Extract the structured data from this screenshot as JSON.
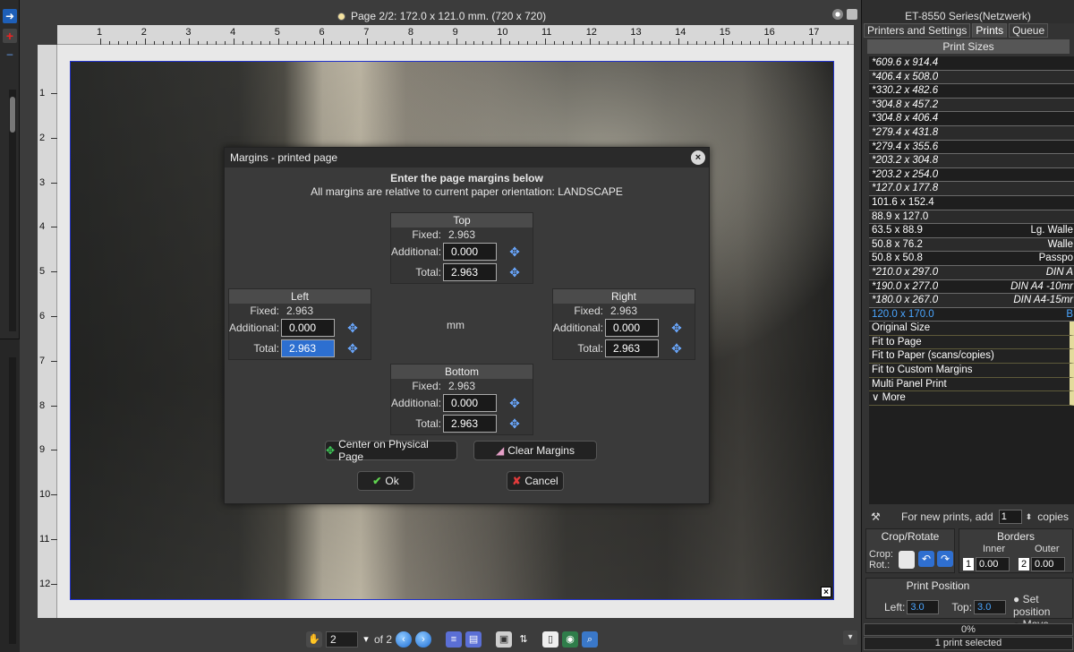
{
  "preview": {
    "page_info": "Page 2/2: 172.0 x 121.0 mm.  (720 x 720)",
    "ruler_top": [
      "1",
      "2",
      "3",
      "4",
      "5",
      "6",
      "7",
      "8",
      "9",
      "10",
      "11",
      "12",
      "13",
      "14",
      "15",
      "16",
      "17"
    ],
    "ruler_left": [
      "1",
      "2",
      "3",
      "4",
      "5",
      "6",
      "7",
      "8",
      "9",
      "10",
      "11",
      "12"
    ],
    "photo_close": "×"
  },
  "bottom_bar": {
    "page_value": "2",
    "of_label": "of 2"
  },
  "dialog": {
    "title": "Margins - printed page",
    "close": "×",
    "heading": "Enter the page margins below",
    "subheading": "All margins are relative to current paper orientation: LANDSCAPE",
    "unit": "mm",
    "fixed_label": "Fixed:",
    "additional_label": "Additional:",
    "total_label": "Total:",
    "top": {
      "title": "Top",
      "fixed": "2.963",
      "additional": "0.000",
      "total": "2.963"
    },
    "left": {
      "title": "Left",
      "fixed": "2.963",
      "additional": "0.000",
      "total": "2.963"
    },
    "right": {
      "title": "Right",
      "fixed": "2.963",
      "additional": "0.000",
      "total": "2.963"
    },
    "bottom": {
      "title": "Bottom",
      "fixed": "2.963",
      "additional": "0.000",
      "total": "2.963"
    },
    "center_button": "Center on Physical Page",
    "clear_button": "Clear Margins",
    "ok_button": "Ok",
    "cancel_button": "Cancel"
  },
  "panel": {
    "printer": "ET-8550 Series(Netzwerk)",
    "tabs": [
      "Printers and Settings",
      "Prints",
      "Queue"
    ],
    "active_tab": "Prints",
    "print_sizes_title": "Print Sizes",
    "sizes": [
      {
        "size": "*609.6 x 914.4",
        "name": ""
      },
      {
        "size": "*406.4 x 508.0",
        "name": ""
      },
      {
        "size": "*330.2 x 482.6",
        "name": ""
      },
      {
        "size": "*304.8 x 457.2",
        "name": ""
      },
      {
        "size": "*304.8 x 406.4",
        "name": ""
      },
      {
        "size": "*279.4 x 431.8",
        "name": ""
      },
      {
        "size": "*279.4 x 355.6",
        "name": ""
      },
      {
        "size": "*203.2 x 304.8",
        "name": ""
      },
      {
        "size": "*203.2 x 254.0",
        "name": ""
      },
      {
        "size": "*127.0 x 177.8",
        "name": ""
      },
      {
        "size": "101.6 x 152.4",
        "name": ""
      },
      {
        "size": "88.9 x 127.0",
        "name": ""
      },
      {
        "size": "63.5 x 88.9",
        "name": "Lg. Walle"
      },
      {
        "size": "50.8 x 76.2",
        "name": "Walle"
      },
      {
        "size": "50.8 x 50.8",
        "name": "Passpo"
      },
      {
        "size": "*210.0 x 297.0",
        "name": "DIN A"
      },
      {
        "size": "*190.0 x 277.0",
        "name": "DIN A4 -10mr"
      },
      {
        "size": "*180.0 x 267.0",
        "name": "DIN A4-15mr"
      },
      {
        "size": "120.0 x 170.0",
        "name": "B"
      }
    ],
    "fit_options": [
      "Original Size",
      "Fit to Page",
      "Fit to Paper (scans/copies)",
      "Fit to Custom Margins",
      "Multi Panel Print",
      "∨ More"
    ],
    "copies_label": "For new prints, add",
    "copies_value": "1",
    "copies_suffix": "copies",
    "crop_title": "Crop/Rotate",
    "crop_label": "Crop:",
    "rot_label": "Rot.:",
    "borders_title": "Borders",
    "inner_label": "Inner",
    "outer_label": "Outer",
    "inner_tag": "1",
    "outer_tag": "2",
    "inner_value": "0.00",
    "outer_value": "0.00",
    "position_title": "Print Position",
    "left_label": "Left:",
    "left_value": "3.0",
    "top_label": "Top:",
    "top_value": "3.0",
    "set_position": "Set position",
    "move": "Move",
    "progress": "0%",
    "selected": "1 print selected"
  },
  "colors": {
    "accent_blue": "#4aa5ff",
    "fit_highlight": "#e3db9c",
    "paper_border": "#2233cc"
  }
}
